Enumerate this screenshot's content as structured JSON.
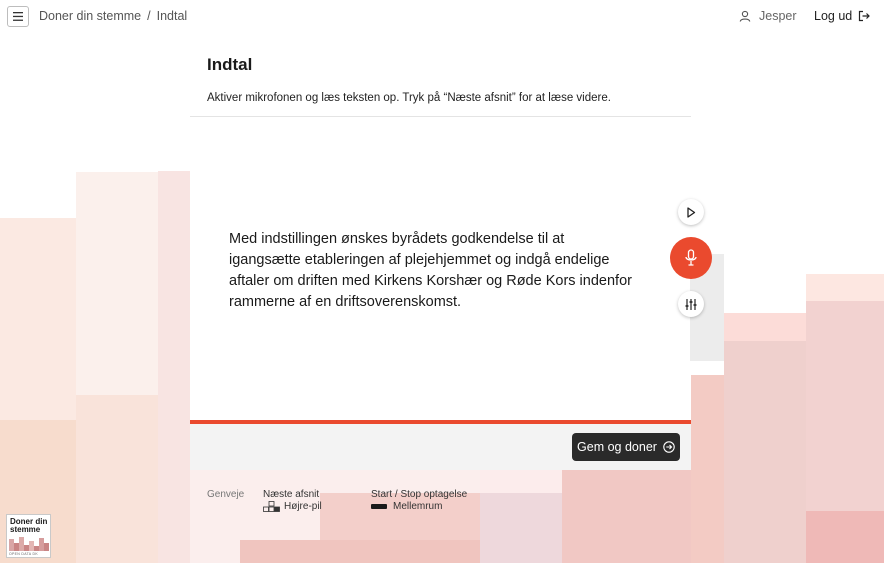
{
  "header": {
    "menu_icon": "hamburger-menu-icon",
    "breadcrumb": {
      "root": "Doner din stemme",
      "separator": "/",
      "current": "Indtal"
    },
    "user": {
      "icon": "user-icon",
      "name": "Jesper"
    },
    "logout": {
      "label": "Log ud",
      "icon": "logout-icon"
    }
  },
  "page": {
    "title": "Indtal",
    "instruction": "Aktiver mikrofonen og læs teksten op. Tryk på “Næste afsnit” for at læse videre."
  },
  "prompt": {
    "text": "Med indstillingen ønskes byrådets godkendelse til at igangsætte etableringen af plejehjemmet og indgå endelige aftaler om driften med Kirkens Korshær og Røde Kors indenfor rammerne af en driftsoverenskomst."
  },
  "controls": {
    "play_icon": "play-icon",
    "mic_icon": "microphone-icon",
    "settings_icon": "sliders-icon"
  },
  "footer": {
    "donate_label": "Gem og doner",
    "donate_icon": "arrow-right-circle-icon"
  },
  "shortcuts": {
    "heading": "Genveje",
    "next": {
      "label": "Næste afsnit",
      "key": "Højre-pil"
    },
    "record": {
      "label": "Start / Stop optagelse",
      "key": "Mellemrum"
    }
  },
  "logo": {
    "line1": "Doner din",
    "line2": "stemme",
    "footer": "OPEN DATA DK"
  },
  "colors": {
    "accent": "#ea4a2e",
    "button_dark": "#2a2a2a",
    "card_footer": "#f3f3f3"
  }
}
